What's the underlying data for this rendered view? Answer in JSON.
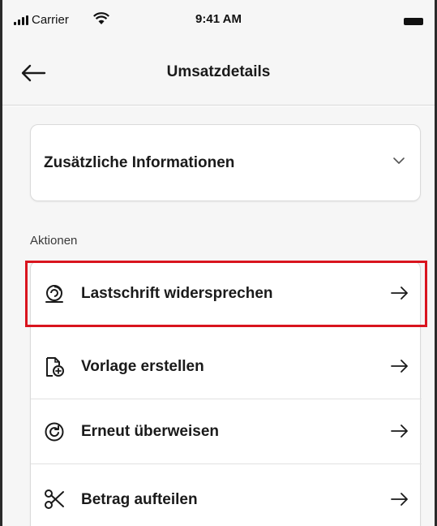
{
  "status_bar": {
    "carrier": "Carrier",
    "time": "9:41 AM",
    "icons": [
      "signal-icon",
      "wifi-icon",
      "battery-icon"
    ]
  },
  "header": {
    "title": "Umsatzdetails",
    "back_icon": "arrow-left-icon"
  },
  "info_section": {
    "label": "Zusätzliche Informationen",
    "icon": "chevron-down-icon"
  },
  "actions": {
    "heading": "Aktionen",
    "items": [
      {
        "label": "Lastschrift widersprechen",
        "icon": "direct-debit-objection-icon",
        "highlighted": true
      },
      {
        "label": "Vorlage erstellen",
        "icon": "template-add-icon",
        "highlighted": false
      },
      {
        "label": "Erneut überweisen",
        "icon": "repeat-transfer-icon",
        "highlighted": false
      },
      {
        "label": "Betrag aufteilen",
        "icon": "scissors-icon",
        "highlighted": false
      }
    ]
  },
  "colors": {
    "highlight_border": "#d9141e",
    "background": "#f6f6f6",
    "card": "#ffffff",
    "text": "#1a1a1a"
  }
}
